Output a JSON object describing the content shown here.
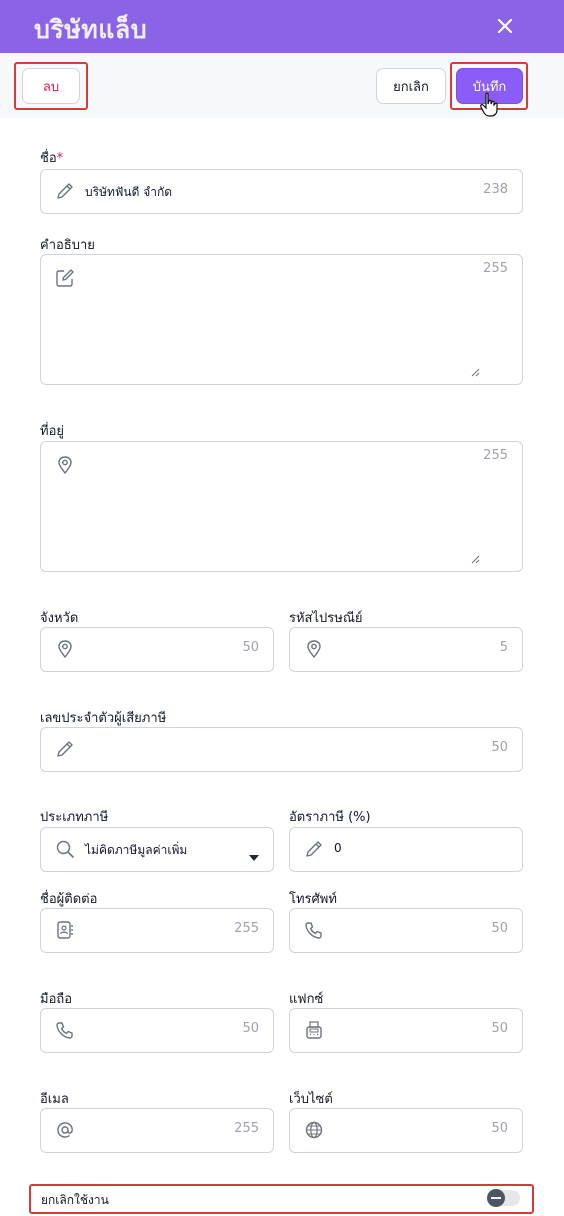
{
  "header": {
    "title": "บริษัทแล็บ",
    "close_icon": "close-icon"
  },
  "toolbar": {
    "delete_label": "ลบ",
    "cancel_label": "ยกเลิก",
    "save_label": "บันทึก"
  },
  "form": {
    "name": {
      "label": "ชื่อ",
      "required_mark": "*",
      "value": "บริษัทฟันดี จำกัด",
      "counter": "238"
    },
    "description": {
      "label": "คำอธิบาย",
      "value": "",
      "counter": "255"
    },
    "address": {
      "label": "ที่อยู่",
      "value": "",
      "counter": "255"
    },
    "province": {
      "label": "จังหวัด",
      "value": "",
      "counter": "50"
    },
    "postal_code": {
      "label": "รหัสไปรษณีย์",
      "value": "",
      "counter": "5"
    },
    "tax_id": {
      "label": "เลขประจำตัวผู้เสียภาษี",
      "value": "",
      "counter": "50"
    },
    "tax_type": {
      "label": "ประเภทภาษี",
      "selected": "ไม่คิดภาษีมูลค่าเพิ่ม"
    },
    "tax_rate": {
      "label": "อัตราภาษี (%)",
      "value": "0"
    },
    "contact_name": {
      "label": "ชื่อผู้ติดต่อ",
      "value": "",
      "counter": "255"
    },
    "phone": {
      "label": "โทรศัพท์",
      "value": "",
      "counter": "50"
    },
    "mobile": {
      "label": "มือถือ",
      "value": "",
      "counter": "50"
    },
    "fax": {
      "label": "แฟกซ์",
      "value": "",
      "counter": "50"
    },
    "email": {
      "label": "อีเมล",
      "value": "",
      "counter": "255"
    },
    "website": {
      "label": "เว็บไซต์",
      "value": "",
      "counter": "50"
    },
    "deactivate": {
      "label": "ยกเลิกใช้งาน",
      "enabled": false
    }
  },
  "colors": {
    "header": "#8b63e6",
    "primary": "#8b5cf6",
    "danger": "#e11d48",
    "highlight": "#d43c3c"
  }
}
